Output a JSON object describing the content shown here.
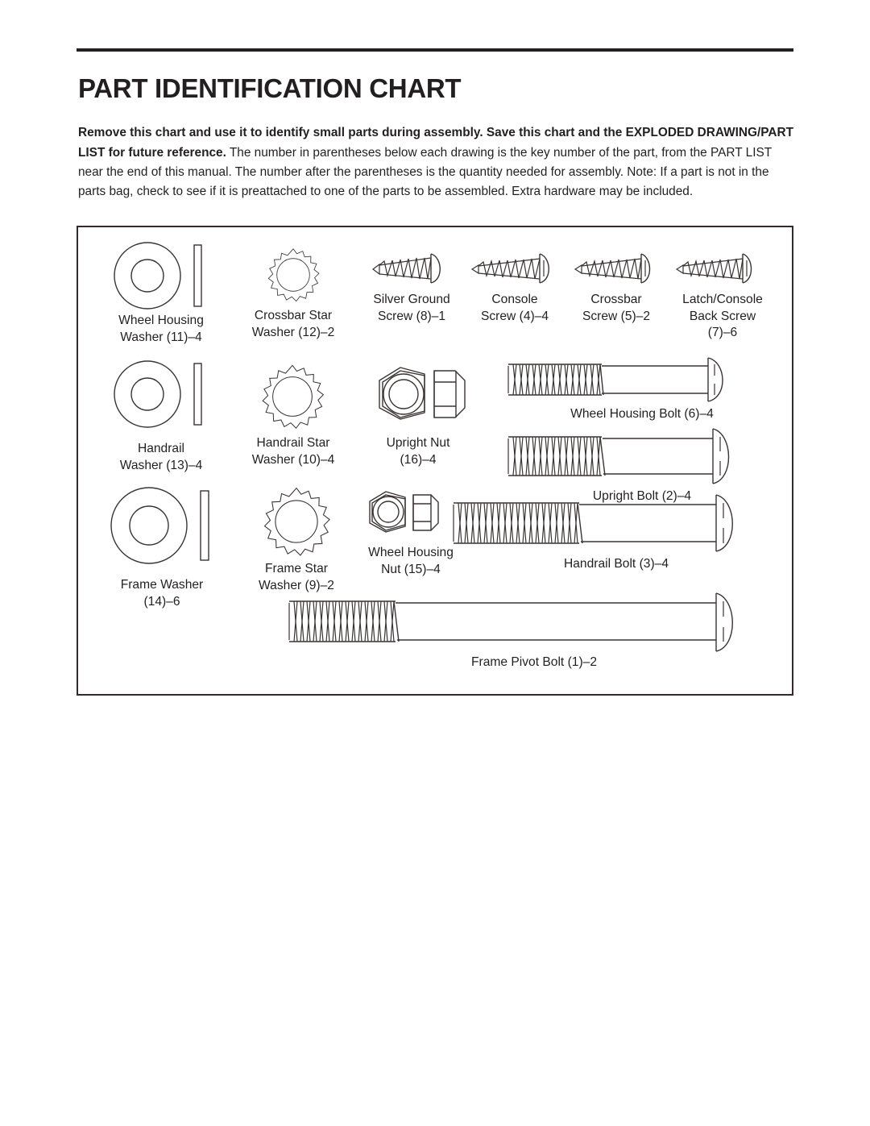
{
  "document": {
    "title": "PART IDENTIFICATION CHART",
    "intro": {
      "bold_lead": "Remove this chart and use it to identify small parts during assembly. Save this chart and the EXPLODED DRAWING/PART LIST for future reference.",
      "body": " The number in parentheses below each drawing is the key number of the part, from the PART LIST near the end of this manual. The number after the parentheses is the quantity needed for assembly. Note: If a part is not in the parts bag, check to see if it is preattached to one of the parts to be assembled. Extra hardware may be included."
    }
  },
  "colors": {
    "ink": "#231f20",
    "line": "#3b3434",
    "border": "#332b2b",
    "paper": "#ffffff"
  },
  "chart": {
    "parts": [
      {
        "id": "wheel-housing-washer",
        "icon": "flat-washer",
        "name": "Wheel Housing",
        "name2": "Washer",
        "key": "11",
        "qty": "4",
        "label": "Wheel Housing\nWasher (11)–4"
      },
      {
        "id": "crossbar-star-washer",
        "icon": "star-washer",
        "name": "Crossbar Star",
        "name2": "Washer",
        "key": "12",
        "qty": "2",
        "label": "Crossbar Star\nWasher (12)–2"
      },
      {
        "id": "silver-ground-screw",
        "icon": "screw",
        "name": "Silver Ground",
        "name2": "Screw",
        "key": "8",
        "qty": "1",
        "label": "Silver Ground\nScrew (8)–1"
      },
      {
        "id": "console-screw",
        "icon": "screw",
        "name": "Console",
        "name2": "Screw",
        "key": "4",
        "qty": "4",
        "label": "Console\nScrew (4)–4"
      },
      {
        "id": "crossbar-screw",
        "icon": "screw",
        "name": "Crossbar",
        "name2": "Screw",
        "key": "5",
        "qty": "2",
        "label": "Crossbar\nScrew (5)–2"
      },
      {
        "id": "latch-console-back-screw",
        "icon": "screw",
        "name": "Latch/Console",
        "name2": "Back Screw",
        "key": "7",
        "qty": "6",
        "label": "Latch/Console\nBack Screw\n(7)–6"
      },
      {
        "id": "handrail-washer",
        "icon": "flat-washer",
        "name": "Handrail",
        "name2": "Washer",
        "key": "13",
        "qty": "4",
        "label": "Handrail\nWasher (13)–4"
      },
      {
        "id": "handrail-star-washer",
        "icon": "star-washer",
        "name": "Handrail Star",
        "name2": "Washer",
        "key": "10",
        "qty": "4",
        "label": "Handrail Star\nWasher (10)–4"
      },
      {
        "id": "upright-nut",
        "icon": "hex-nut",
        "name": "Upright Nut",
        "key": "16",
        "qty": "4",
        "label": "Upright Nut\n(16)–4"
      },
      {
        "id": "wheel-housing-bolt",
        "icon": "bolt",
        "name": "Wheel Housing Bolt",
        "key": "6",
        "qty": "4",
        "label": "Wheel Housing Bolt (6)–4"
      },
      {
        "id": "upright-bolt",
        "icon": "bolt",
        "name": "Upright Bolt",
        "key": "2",
        "qty": "4",
        "label": "Upright Bolt (2)–4"
      },
      {
        "id": "frame-washer",
        "icon": "flat-washer",
        "name": "Frame Washer",
        "key": "14",
        "qty": "6",
        "label": "Frame Washer\n(14)–6"
      },
      {
        "id": "frame-star-washer",
        "icon": "star-washer",
        "name": "Frame Star",
        "name2": "Washer",
        "key": "9",
        "qty": "2",
        "label": "Frame Star\nWasher (9)–2"
      },
      {
        "id": "wheel-housing-nut",
        "icon": "hex-nut",
        "name": "Wheel Housing",
        "name2": "Nut",
        "key": "15",
        "qty": "4",
        "label": "Wheel Housing\nNut (15)–4"
      },
      {
        "id": "handrail-bolt",
        "icon": "bolt",
        "name": "Handrail Bolt",
        "key": "3",
        "qty": "4",
        "label": "Handrail Bolt (3)–4"
      },
      {
        "id": "frame-pivot-bolt",
        "icon": "bolt",
        "name": "Frame Pivot Bolt",
        "key": "1",
        "qty": "2",
        "label": "Frame Pivot Bolt (1)–2"
      }
    ]
  }
}
